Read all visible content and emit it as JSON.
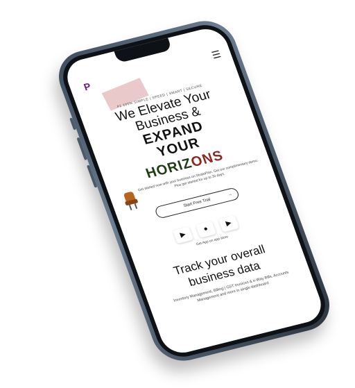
{
  "header": {
    "logo_text": "P",
    "menu_icon": "hamburger-icon"
  },
  "hero": {
    "tagline": "#1 100% SIMPLE | SPEED | SMART | SECURE",
    "line1": "We Elevate Your",
    "line2": "Business &",
    "line3": "EXPAND",
    "line4": "YOUR",
    "line5a": "HORIZ",
    "line5b": "ONS",
    "description": "Get started now with your business on StratoPlan. Get our complimentary demo. Plus get started for up to 30 days."
  },
  "cta": {
    "label": "Start Free Trial",
    "arrow": "→"
  },
  "stores": {
    "icons": [
      "play-store-icon",
      "apple-icon",
      "play-store-icon"
    ],
    "label": "Get App on app store"
  },
  "track": {
    "title_line1": "Track your overall",
    "title_line2": "business data",
    "subtitle": "Inventory Management, Billing | GST Invoices & e-Way Bills, Accounts Management and more in single dashboard"
  }
}
